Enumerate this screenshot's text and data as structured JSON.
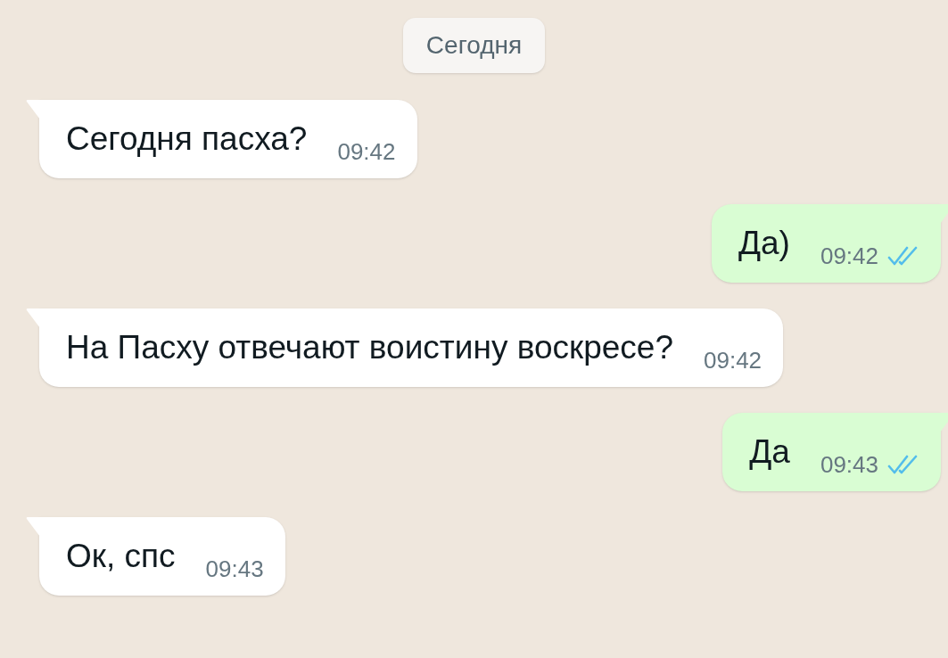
{
  "date_chip": "Сегодня",
  "messages": [
    {
      "kind": "incoming",
      "text": "Сегодня пасха?",
      "time": "09:42"
    },
    {
      "kind": "outgoing",
      "text": "Да)",
      "time": "09:42",
      "read": true
    },
    {
      "kind": "incoming",
      "text": "На Пасху отвечают воистину воскресе?",
      "time": "09:42"
    },
    {
      "kind": "outgoing",
      "text": "Да",
      "time": "09:43",
      "read": true
    },
    {
      "kind": "incoming",
      "text": "Ок, спс",
      "time": "09:43"
    }
  ]
}
